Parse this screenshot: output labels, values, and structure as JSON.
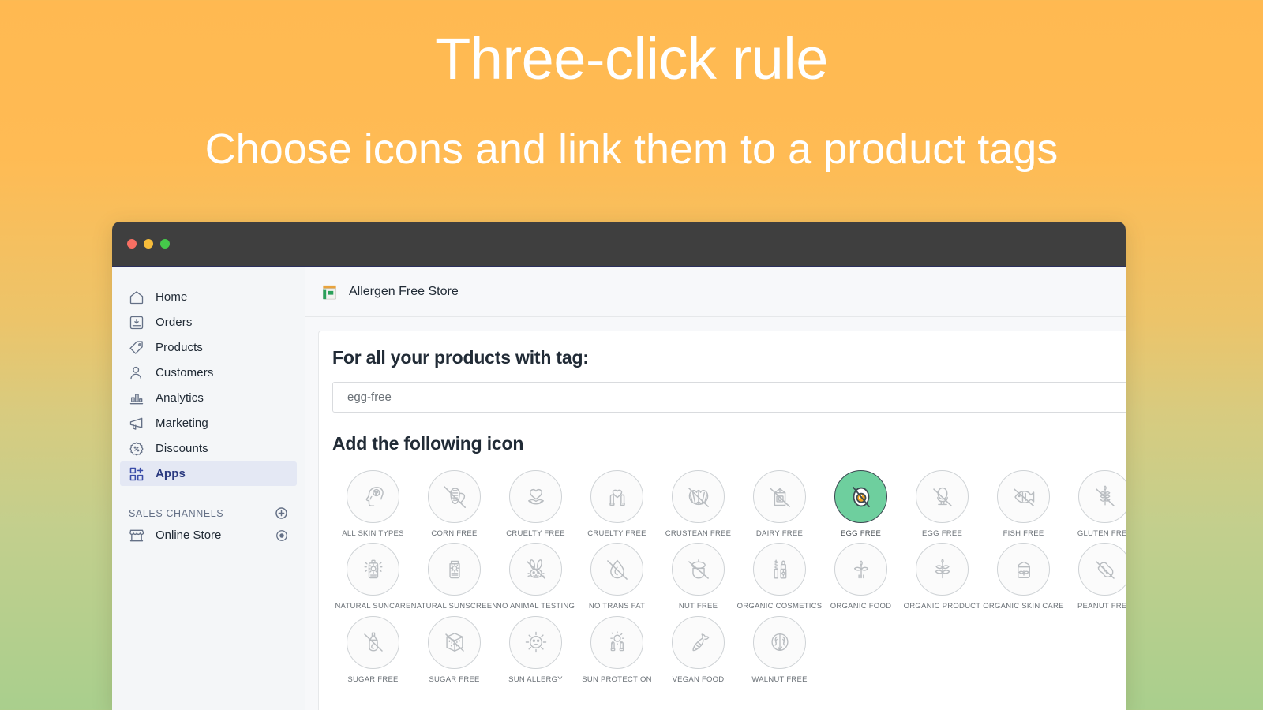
{
  "hero": {
    "title": "Three-click rule",
    "subtitle": "Choose icons and link them to a product tags"
  },
  "window": {
    "traffic_lights": [
      "close",
      "minimize",
      "maximize"
    ],
    "colors": {
      "close": "#f76f63",
      "minimize": "#f7bd3b",
      "maximize": "#45c94a"
    }
  },
  "sidebar": {
    "items": [
      {
        "label": "Home",
        "icon": "home-icon",
        "active": false
      },
      {
        "label": "Orders",
        "icon": "orders-icon",
        "active": false
      },
      {
        "label": "Products",
        "icon": "products-tag-icon",
        "active": false
      },
      {
        "label": "Customers",
        "icon": "customers-icon",
        "active": false
      },
      {
        "label": "Analytics",
        "icon": "analytics-bar-chart-icon",
        "active": false
      },
      {
        "label": "Marketing",
        "icon": "marketing-megaphone-icon",
        "active": false
      },
      {
        "label": "Discounts",
        "icon": "discounts-percent-icon",
        "active": false
      },
      {
        "label": "Apps",
        "icon": "apps-grid-plus-icon",
        "active": true
      }
    ],
    "sales_channels": {
      "title": "SALES CHANNELS",
      "add_icon": "plus-circle-icon",
      "items": [
        {
          "label": "Online Store",
          "icon": "storefront-icon",
          "trailing_icon": "eye-icon"
        }
      ]
    },
    "active_highlight_color": "#e4e8f4",
    "active_text_color": "#2b3a80"
  },
  "main": {
    "store": {
      "name": "Allergen Free Store",
      "icon": "store-jar-icon"
    },
    "tag_section": {
      "heading": "For all your products with tag:",
      "input_value": "egg-free",
      "input_placeholder": "egg-free"
    },
    "icon_section": {
      "heading": "Add the following icon",
      "selected_color": "#6ecf9e",
      "selected_accent_color": "#f5a623",
      "icons": [
        {
          "label": "ALL SKIN TYPES",
          "icon": "all-skin-types-icon",
          "selected": false
        },
        {
          "label": "CORN FREE",
          "icon": "corn-free-icon",
          "selected": false
        },
        {
          "label": "CRUELTY FREE",
          "icon": "cruelty-free-heart-leaf-icon",
          "selected": false
        },
        {
          "label": "CRUELTY FREE",
          "icon": "cruelty-free-hands-heart-icon",
          "selected": false
        },
        {
          "label": "CRUSTEAN FREE",
          "icon": "crustean-free-shell-icon",
          "selected": false
        },
        {
          "label": "DAIRY FREE",
          "icon": "dairy-free-carton-icon",
          "selected": false
        },
        {
          "label": "EGG FREE",
          "icon": "egg-free-yolk-icon",
          "selected": true
        },
        {
          "label": "EGG FREE",
          "icon": "egg-free-eggcup-icon",
          "selected": false
        },
        {
          "label": "FISH FREE",
          "icon": "fish-free-icon",
          "selected": false
        },
        {
          "label": "GLUTEN FREE",
          "icon": "gluten-free-wheat-icon",
          "selected": false
        },
        {
          "label": "NATURAL SUNCARE",
          "icon": "natural-suncare-bottle-icon",
          "selected": false
        },
        {
          "label": "NATURAL SUNSCREEN",
          "icon": "natural-sunscreen-tube-icon",
          "selected": false
        },
        {
          "label": "NO ANIMAL TESTING",
          "icon": "no-animal-testing-rabbit-icon",
          "selected": false
        },
        {
          "label": "NO TRANS FAT",
          "icon": "no-trans-fat-droplet-icon",
          "selected": false
        },
        {
          "label": "NUT FREE",
          "icon": "nut-free-acorn-icon",
          "selected": false
        },
        {
          "label": "ORGANIC COSMETICS",
          "icon": "organic-cosmetics-lipstick-icon",
          "selected": false
        },
        {
          "label": "ORGANIC FOOD",
          "icon": "organic-food-sprout-icon",
          "selected": false
        },
        {
          "label": "ORGANIC PRODUCT",
          "icon": "organic-product-plant-icon",
          "selected": false
        },
        {
          "label": "ORGANIC SKIN CARE",
          "icon": "organic-skin-care-jar-icon",
          "selected": false
        },
        {
          "label": "PEANUT FREE",
          "icon": "peanut-free-icon",
          "selected": false
        },
        {
          "label": "SUGAR FREE",
          "icon": "sugar-free-bottle-icon",
          "selected": false
        },
        {
          "label": "SUGAR FREE",
          "icon": "sugar-free-cube-icon",
          "selected": false
        },
        {
          "label": "SUN ALLERGY",
          "icon": "sun-allergy-sad-sun-icon",
          "selected": false
        },
        {
          "label": "SUN PROTECTION",
          "icon": "sun-protection-hands-icon",
          "selected": false
        },
        {
          "label": "VEGAN FOOD",
          "icon": "vegan-food-carrot-icon",
          "selected": false
        },
        {
          "label": "WALNUT FREE",
          "icon": "walnut-free-icon",
          "selected": false
        }
      ]
    }
  }
}
